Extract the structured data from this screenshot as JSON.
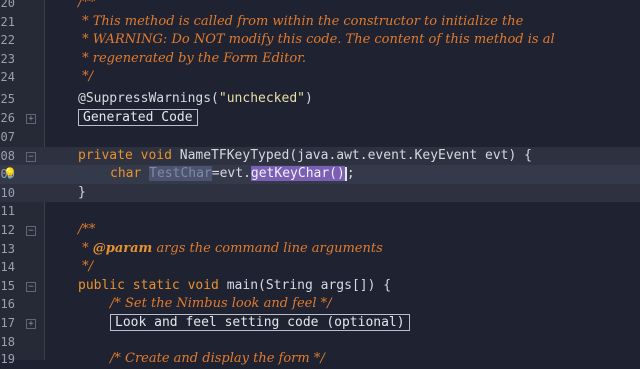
{
  "editor": {
    "lines": [
      {
        "num": "20",
        "text": "/**"
      },
      {
        "num": "21",
        "text": " * This method is called from within the constructor to initialize the"
      },
      {
        "num": "22",
        "text": " * WARNING: Do NOT modify this code. The content of this method is al"
      },
      {
        "num": "23",
        "text": " * regenerated by the Form Editor."
      },
      {
        "num": "24",
        "text": " */"
      },
      {
        "num": "25",
        "annotation": "@SuppressWarnings(",
        "string": "\"unchecked\"",
        "close": ")"
      },
      {
        "num": "26",
        "folded": "Generated Code"
      },
      {
        "num": "07",
        "text": ""
      },
      {
        "num": "08",
        "kw": "private void ",
        "text": "NameTFKeyTyped(java.awt.event.KeyEvent evt) {"
      },
      {
        "num": "09",
        "kw": "char ",
        "var": "TestChar",
        "op": "=evt.",
        "call": "getKeyChar()",
        "end": ";"
      },
      {
        "num": "10",
        "text": "}"
      },
      {
        "num": "11",
        "text": ""
      },
      {
        "num": "12",
        "text": "/**"
      },
      {
        "num": "13",
        "prefix": " * ",
        "tag": "@param",
        "text": " args the command line arguments"
      },
      {
        "num": "14",
        "text": " */"
      },
      {
        "num": "15",
        "kw1": "public static void ",
        "text": "main(String args[]) {"
      },
      {
        "num": "16",
        "text": "/* Set the Nimbus look and feel */"
      },
      {
        "num": "17",
        "folded": "Look and feel setting code (optional)"
      },
      {
        "num": "18",
        "text": ""
      },
      {
        "num": "19",
        "text": "/* Create and display the form */"
      }
    ]
  },
  "icons": {
    "fold": "fold-toggle-icon",
    "hint": "lightbulb-hint-icon"
  },
  "colors": {
    "background": "#1f2331",
    "keyword": "#e8922f",
    "comment": "#7f8aa0",
    "highlight": "#7a5fb5"
  }
}
